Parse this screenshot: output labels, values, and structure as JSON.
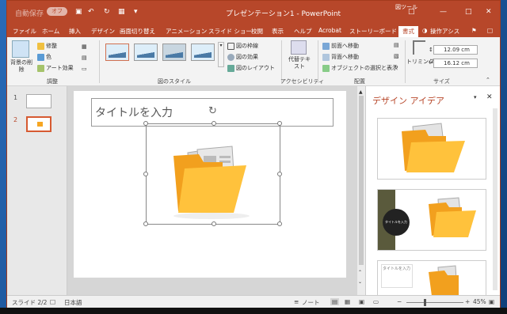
{
  "titlebar": {
    "autosave_label": "自動保存",
    "autosave_state": "オフ",
    "title": "プレゼンテーション1 - PowerPoint",
    "context_label": "図ツール"
  },
  "tabs": [
    {
      "label": "ファイル"
    },
    {
      "label": "ホーム"
    },
    {
      "label": "挿入"
    },
    {
      "label": "デザイン"
    },
    {
      "label": "画面切り替え"
    },
    {
      "label": "アニメーション"
    },
    {
      "label": "スライド ショー"
    },
    {
      "label": "校閲"
    },
    {
      "label": "表示"
    },
    {
      "label": "ヘルプ"
    },
    {
      "label": "Acrobat"
    },
    {
      "label": "ストーリーボード"
    },
    {
      "label": "書式"
    }
  ],
  "tell_me": "操作アシス",
  "ribbon": {
    "remove_bg": "背景の削除",
    "corrections": "修整",
    "color": "色",
    "artistic": "アート効果",
    "adjust_group": "調整",
    "styles_group": "図のスタイル",
    "border": "図の枠線",
    "effects": "図の効果",
    "layout": "図のレイアウト",
    "alt_text": "代替テキスト",
    "a11y_group": "アクセシビリティ",
    "bring_forward": "前面へ移動",
    "send_backward": "背面へ移動",
    "selection_pane": "オブジェクトの選択と表示",
    "arrange_group": "配置",
    "crop": "トリミング",
    "height": "12.09 cm",
    "width": "16.12 cm",
    "size_group": "サイズ"
  },
  "thumbs": [
    {
      "num": "1"
    },
    {
      "num": "2"
    }
  ],
  "slide": {
    "title_placeholder": "タイトルを入力"
  },
  "design_pane": {
    "title": "デザイン アイデア",
    "idea2_caption": "タイトルを入力",
    "idea3_caption": "タイトルを入力"
  },
  "status": {
    "slide_info": "スライド 2/2",
    "language": "日本語",
    "notes": "ノート",
    "zoom": "45%"
  },
  "colors": {
    "accent": "#b7472a",
    "folder": "#f6a623"
  }
}
